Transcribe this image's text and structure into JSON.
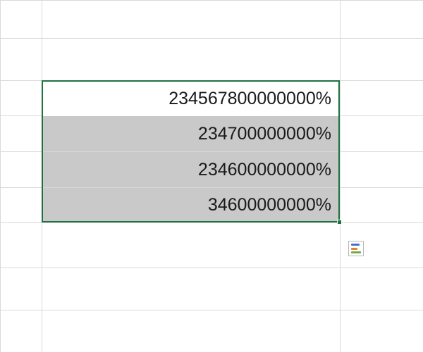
{
  "cells": {
    "r1": "234567800000000%",
    "r2": "234700000000%",
    "r3": "234600000000%",
    "r4": "34600000000%"
  }
}
